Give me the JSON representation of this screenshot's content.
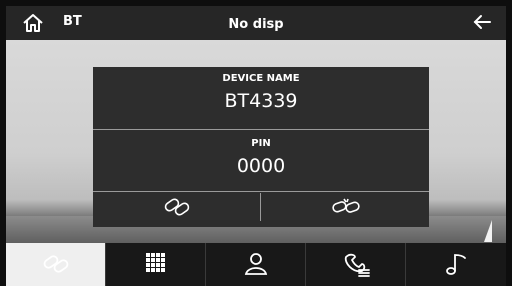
{
  "topbar": {
    "app_label": "BT",
    "title": "No disp"
  },
  "device": {
    "name_label": "DEVICE NAME",
    "name_value": "BT4339",
    "pin_label": "PIN",
    "pin_value": "0000"
  },
  "actions": {
    "connect_icon": "link-icon",
    "disconnect_icon": "unlink-icon"
  },
  "nav": {
    "tabs": [
      {
        "icon": "link-icon",
        "active": true
      },
      {
        "icon": "keypad-icon",
        "active": false
      },
      {
        "icon": "contacts-icon",
        "active": false
      },
      {
        "icon": "call-log-icon",
        "active": false
      },
      {
        "icon": "music-icon",
        "active": false
      }
    ]
  },
  "colors": {
    "bar": "#262626",
    "panel": "#2d2d2d",
    "active_tab": "#efefef",
    "text": "#ffffff"
  }
}
